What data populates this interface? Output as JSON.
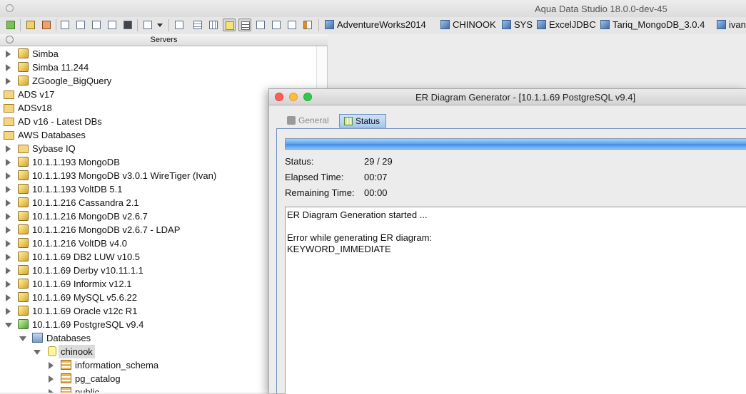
{
  "app": {
    "title": "Aqua Data Studio 18.0.0-dev-45"
  },
  "toolbar": {
    "shortcuts": [
      {
        "label": "AdventureWorks2014"
      },
      {
        "label": "CHINOOK"
      },
      {
        "label": "SYS"
      },
      {
        "label": "ExcelJDBC"
      },
      {
        "label": "Tariq_MongoDB_3.0.4"
      },
      {
        "label": "ivan"
      }
    ]
  },
  "servers_panel": {
    "title": "Servers"
  },
  "tree": {
    "items": [
      {
        "label": "Simba",
        "icon": "server-icon",
        "expanded": false
      },
      {
        "label": "Simba 11.244",
        "icon": "server-icon",
        "expanded": false
      },
      {
        "label": "ZGoogle_BigQuery",
        "icon": "server-icon",
        "expanded": false
      },
      {
        "label": "ADS v17",
        "icon": "folder-icon"
      },
      {
        "label": "ADSv18",
        "icon": "folder-icon"
      },
      {
        "label": "AD v16 - Latest DBs",
        "icon": "folder-icon"
      },
      {
        "label": "AWS Databases",
        "icon": "folder-icon"
      },
      {
        "label": "Sybase IQ",
        "icon": "folder-icon",
        "expanded": false
      },
      {
        "label": "10.1.1.193 MongoDB",
        "icon": "server-icon",
        "expanded": false
      },
      {
        "label": "10.1.1.193 MongoDB v3.0.1 WireTiger (Ivan)",
        "icon": "server-icon",
        "expanded": false
      },
      {
        "label": "10.1.1.193 VoltDB 5.1",
        "icon": "server-icon",
        "expanded": false
      },
      {
        "label": "10.1.1.216 Cassandra 2.1",
        "icon": "server-icon",
        "expanded": false
      },
      {
        "label": "10.1.1.216 MongoDB v2.6.7",
        "icon": "server-icon",
        "expanded": false
      },
      {
        "label": "10.1.1.216 MongoDB v2.6.7 - LDAP",
        "icon": "server-icon",
        "expanded": false
      },
      {
        "label": "10.1.1.216 VoltDB  v4.0",
        "icon": "server-icon",
        "expanded": false
      },
      {
        "label": "10.1.1.69 DB2 LUW v10.5",
        "icon": "server-icon",
        "expanded": false
      },
      {
        "label": "10.1.1.69 Derby v10.11.1.1",
        "icon": "server-icon",
        "expanded": false
      },
      {
        "label": "10.1.1.69 Informix v12.1",
        "icon": "server-icon",
        "expanded": false
      },
      {
        "label": "10.1.1.69 MySQL v5.6.22",
        "icon": "server-icon",
        "expanded": false
      },
      {
        "label": "10.1.1.69 Oracle  v12c R1",
        "icon": "server-icon",
        "expanded": false
      },
      {
        "label": "10.1.1.69 PostgreSQL  v9.4",
        "icon": "connected-server-icon",
        "expanded": true
      },
      {
        "label": "Databases",
        "icon": "databases-icon",
        "expanded": true
      },
      {
        "label": "chinook",
        "icon": "database-icon",
        "expanded": true,
        "selected": true
      },
      {
        "label": "information_schema",
        "icon": "schema-icon",
        "expanded": false
      },
      {
        "label": "pg_catalog",
        "icon": "schema-icon",
        "expanded": false
      },
      {
        "label": "public",
        "icon": "schema-icon",
        "expanded": false
      }
    ]
  },
  "dialog": {
    "title": "ER Diagram Generator - [10.1.1.69 PostgreSQL  v9.4]",
    "tabs": {
      "general": "General",
      "status": "Status",
      "active": "Status"
    },
    "progress": 1.0,
    "status_label": "Status:",
    "status_value": "29 / 29",
    "elapsed_label": "Elapsed Time:",
    "elapsed_value": "00:07",
    "remaining_label": "Remaining Time:",
    "remaining_value": "00:00",
    "log_lines": [
      "ER Diagram Generation started ...",
      "",
      "Error while generating ER diagram:",
      "KEYWORD_IMMEDIATE"
    ]
  }
}
